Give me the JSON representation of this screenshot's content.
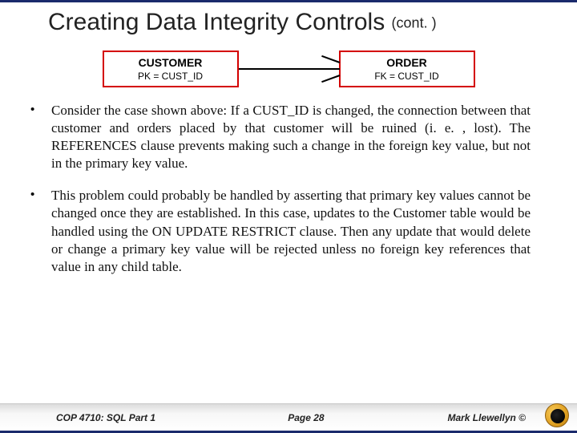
{
  "title": {
    "main": "Creating Data Integrity Controls",
    "cont": "(cont. )"
  },
  "diagram": {
    "left": {
      "name": "CUSTOMER",
      "key": "PK = CUST_ID"
    },
    "right": {
      "name": "ORDER",
      "key": "FK = CUST_ID"
    }
  },
  "bullets": [
    "Consider the case shown above:  If a CUST_ID is changed, the connection between that customer and orders placed by that customer will be ruined (i. e. , lost).  The REFERENCES clause prevents making such a change in the foreign key value, but not in the primary key value.",
    "This problem could probably be handled by asserting that primary key values cannot be changed once they are established.  In this case, updates to the Customer table would be handled using the ON UPDATE RESTRICT clause.  Then any update that would delete or change a primary key value will be rejected unless no foreign key references that value in any child table."
  ],
  "footer": {
    "left": "COP 4710: SQL Part 1",
    "center": "Page 28",
    "right": "Mark Llewellyn ©"
  }
}
